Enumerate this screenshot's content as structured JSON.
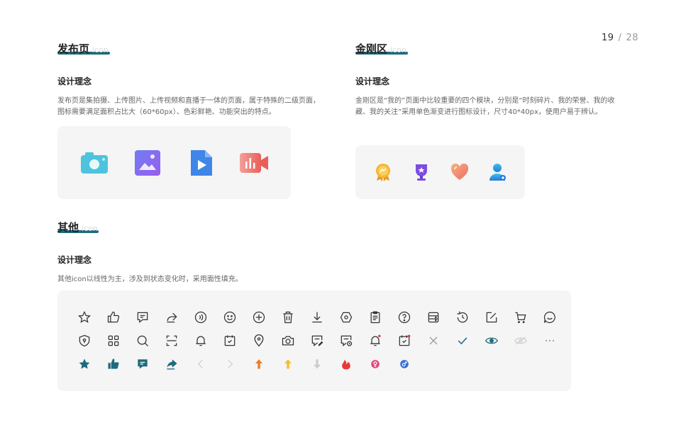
{
  "pager": {
    "current": "19",
    "separator": "/",
    "total": "28"
  },
  "publish": {
    "title": "发布页",
    "subtitle": "icon",
    "concept_heading": "设计理念",
    "description": "发布页是集拍摄、上传图片、上传视频和直播于一体的页面，属于特殊的二级页面，图标需要满足面积占比大（60*60px）、色彩鲜艳、功能突出的特点。",
    "icons": [
      "camera-icon",
      "image-upload-icon",
      "video-file-icon",
      "live-stream-icon"
    ],
    "colors": {
      "camera": "#4dc4de",
      "image": "#8f6cf0",
      "video": "#3f86e8",
      "live": "#ef7b78"
    }
  },
  "kingkong": {
    "title": "金刚区",
    "subtitle": "icon",
    "concept_heading": "设计理念",
    "description": "金刚区是“我的”页面中比较重要的四个模块，分别是“时刻碎片、我的荣誉、我的收藏、我的关注”采用单色渐变进行图标设计，尺寸40*40px，使用户易于辨认。",
    "icons": [
      "medal-icon",
      "trophy-icon",
      "heart-icon",
      "user-add-icon"
    ],
    "colors": {
      "medal": "#f5b731",
      "trophy": "#7c4de0",
      "heart": "#f28a6a",
      "user": "#2e8fe0"
    }
  },
  "others": {
    "title": "其他",
    "subtitle": "icon",
    "concept_heading": "设计理念",
    "description": "其他icon以线性为主，涉及到状态变化时，采用面性填充。",
    "row1": [
      "star-icon",
      "thumb-up-icon",
      "comment-icon",
      "share-icon",
      "audio-icon",
      "smile-icon",
      "plus-circle-icon",
      "trash-icon",
      "download-icon",
      "settings-hex-icon",
      "clipboard-icon",
      "help-icon",
      "server-icon",
      "history-icon",
      "edit-icon",
      "cart-icon",
      "chat-bubble-icon"
    ],
    "row2": [
      "shield-icon",
      "grid-icon",
      "search-icon",
      "scan-icon",
      "bell-icon",
      "calendar-check-icon",
      "location-icon",
      "camera-outline-icon",
      "message-edit-icon",
      "message-time-icon",
      "bell-dot-icon",
      "calendar-dot-icon",
      "close-icon",
      "check-icon",
      "eye-icon",
      "eye-hidden-icon",
      "more-icon"
    ],
    "row3": [
      "star-filled-icon",
      "thumb-up-filled-icon",
      "comment-filled-icon",
      "share-filled-icon",
      "chevron-left-icon",
      "chevron-right-icon",
      "arrow-up-orange-icon",
      "arrow-up-yellow-icon",
      "arrow-down-gray-icon",
      "flame-icon",
      "female-icon",
      "male-icon"
    ],
    "colors": {
      "line": "#333333",
      "accent": "#1d6b7e",
      "orange": "#f07a23",
      "yellow": "#f5bd2a",
      "gray": "#cccccc",
      "red": "#e8383b",
      "pink": "#e8487a",
      "blue": "#3a6fd8"
    }
  }
}
